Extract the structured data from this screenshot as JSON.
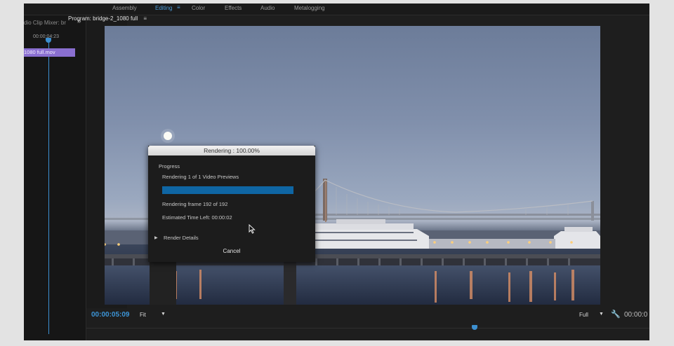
{
  "workspaces": {
    "tabs": [
      "Assembly",
      "Editing",
      "Color",
      "Effects",
      "Audio",
      "Metalogging"
    ],
    "active": "Editing",
    "menu_glyph": "≡"
  },
  "left_panel": {
    "title": "dio Clip Mixer: br",
    "expand_glyph": "»",
    "timecode": "00:00:04:23",
    "clip_name": "1080 full.mov"
  },
  "monitor": {
    "title": "Program: bridge-2_1080 full",
    "menu_glyph": "≡",
    "timecode": "00:00:05:09",
    "fit_label": "Fit",
    "resolution_label": "Full",
    "right_timecode": "00:00:0",
    "dropdown_glyph": "▼",
    "wrench_glyph": "🔧",
    "playhead_fraction": 0.684
  },
  "dialog": {
    "title": "Rendering : 100.00%",
    "section_label": "Progress",
    "status": "Rendering 1 of 1 Video Previews",
    "progress": 1.0,
    "frame_status": "Rendering frame 192 of 192",
    "time_left": "Estimated Time Left: 00:00:02",
    "details_label": "Render Details",
    "disclosure_glyph": "▶",
    "cancel_label": "Cancel"
  },
  "colors": {
    "accent": "#3c94d6",
    "clip": "#8a6fd0",
    "progress_fill": "#0f66a4"
  }
}
